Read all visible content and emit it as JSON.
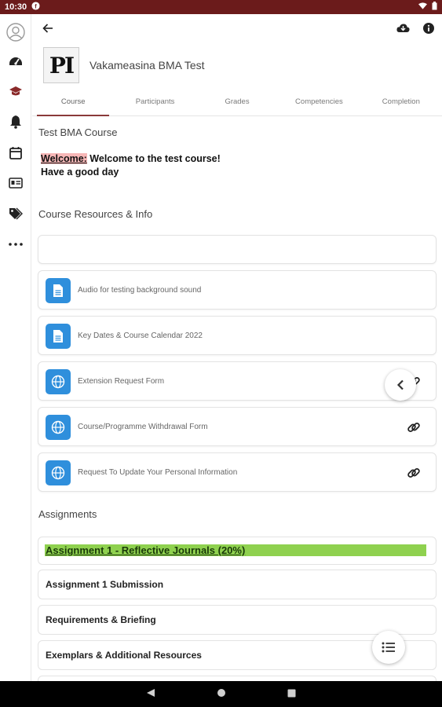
{
  "status_bar": {
    "time": "10:30"
  },
  "sidebar": {
    "items": [
      {
        "icon": "avatar-icon"
      },
      {
        "icon": "dashboard-icon"
      },
      {
        "icon": "graduation-cap-icon",
        "active": true
      },
      {
        "icon": "bell-icon"
      },
      {
        "icon": "calendar-icon"
      },
      {
        "icon": "id-card-icon"
      },
      {
        "icon": "tags-icon"
      },
      {
        "icon": "more-icon"
      }
    ]
  },
  "course": {
    "logo_text": "PI",
    "title": "Vakameasina BMA Test"
  },
  "tabs": [
    {
      "label": "Course",
      "active": true
    },
    {
      "label": "Participants"
    },
    {
      "label": "Grades"
    },
    {
      "label": "Competencies"
    },
    {
      "label": "Completion"
    }
  ],
  "section1": {
    "title": "Test BMA Course",
    "welcome_highlight": "Welcome:",
    "welcome_text": " Welcome to the test course!",
    "line2": "Have a good day"
  },
  "section2": {
    "title": "Course Resources & Info",
    "resources": [
      {
        "label": "Audio for testing background sound",
        "icon": "document-icon",
        "link": false
      },
      {
        "label": "Key Dates & Course Calendar 2022",
        "icon": "document-icon",
        "link": false
      },
      {
        "label": "Extension Request Form",
        "icon": "globe-icon",
        "link": true
      },
      {
        "label": "Course/Programme Withdrawal Form",
        "icon": "globe-icon",
        "link": true
      },
      {
        "label": "Request To Update Your Personal Information",
        "icon": "globe-icon",
        "link": true
      }
    ]
  },
  "section3": {
    "title": "Assignments",
    "highlight_title": "Assignment 1 - Reflective Journals (20%)",
    "items": [
      "Assignment 1 Submission",
      "Requirements & Briefing",
      "Exemplars & Additional Resources"
    ]
  },
  "colors": {
    "status_bar": "#6b1b1b",
    "accent": "#8a3a3a",
    "resource_icon": "#2f8fdc",
    "assignment_highlight": "#8fd14f"
  }
}
